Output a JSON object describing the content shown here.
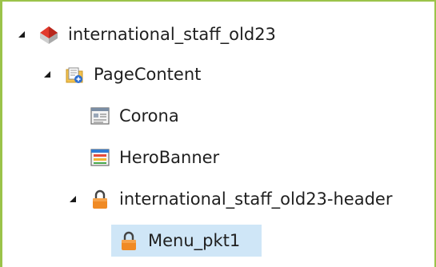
{
  "tree": {
    "root": {
      "label": "international_staff_old23",
      "icon": "site-house-icon",
      "expanded": true,
      "children": [
        {
          "label": "PageContent",
          "icon": "folder-content-icon",
          "expanded": true,
          "children": [
            {
              "label": "Corona",
              "icon": "document-page-icon"
            },
            {
              "label": "HeroBanner",
              "icon": "banner-page-icon"
            },
            {
              "label": "international_staff_old23-header",
              "icon": "lock-icon",
              "expanded": true,
              "children": [
                {
                  "label": "Menu_pkt1",
                  "icon": "lock-icon",
                  "selected": true
                }
              ]
            }
          ]
        }
      ]
    }
  },
  "colors": {
    "frame_border": "#9bc34a",
    "selection": "#cfe6f7",
    "lock": "#f08a24"
  }
}
